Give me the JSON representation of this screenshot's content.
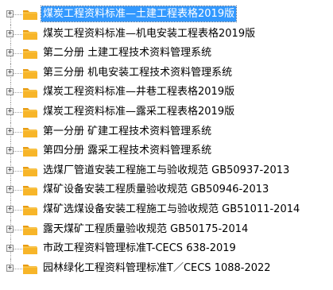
{
  "tree": {
    "items": [
      {
        "label": "煤炭工程资料标准—土建工程表格2019版",
        "expander": "+"
      },
      {
        "label": "煤炭工程资料标准—机电安装工程表格2019版",
        "expander": "+"
      },
      {
        "label": "第二分册 土建工程技术资料管理系统",
        "expander": "+"
      },
      {
        "label": "第三分册 机电安装工程技术资料管理系统",
        "expander": "+"
      },
      {
        "label": "煤炭工程资料标准—井巷工程表格2019版",
        "expander": "+"
      },
      {
        "label": "煤炭工程资料标准—露采工程表格2019版",
        "expander": "+"
      },
      {
        "label": "第一分册 矿建工程技术资料管理系统",
        "expander": "+"
      },
      {
        "label": "第四分册 露采工程技术资料管理系统",
        "expander": "+"
      },
      {
        "label": "选煤厂管道安装工程施工与验收规范 GB50937-2013",
        "expander": "+"
      },
      {
        "label": "煤矿设备安装工程质量验收规范 GB50946-2013",
        "expander": "+"
      },
      {
        "label": "煤矿选煤设备安装工程施工与验收规范 GB51011-2014",
        "expander": "+"
      },
      {
        "label": "露天煤矿工程质量验收规范 GB50175-2014",
        "expander": "+"
      },
      {
        "label": "市政工程资料管理标准T-CECS 638-2019",
        "expander": "+"
      },
      {
        "label": "园林绿化工程资料管理标准T／CECS 1088-2022",
        "expander": "+"
      }
    ]
  },
  "colors": {
    "selection": "#3399ff",
    "folder_body": "#f7b529",
    "folder_tab": "#e89b12"
  },
  "icon": "folder-icon"
}
